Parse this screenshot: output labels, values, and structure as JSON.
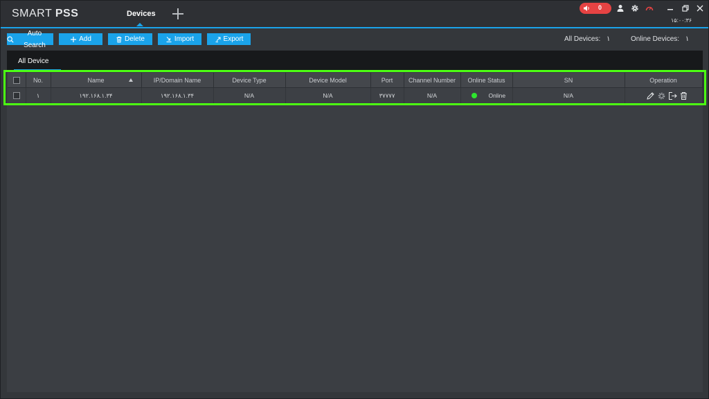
{
  "app": {
    "logo_thin": "SMART ",
    "logo_bold": "PSS",
    "active_tab": "Devices",
    "alarm_count": "0",
    "clock": "۱۵:۰۰:۳۶"
  },
  "toolbar": {
    "auto_search": "Auto Search",
    "add": "Add",
    "delete": "Delete",
    "import": "Import",
    "export": "Export",
    "all_devices_label": "All Devices:",
    "all_devices_count": "۱",
    "online_devices_label": "Online Devices:",
    "online_devices_count": "۱"
  },
  "subtabs": {
    "all_device": "All Device"
  },
  "table": {
    "headers": {
      "no": "No.",
      "name": "Name",
      "ip": "IP/Domain Name",
      "type": "Device Type",
      "model": "Device Model",
      "port": "Port",
      "channel": "Channel Number",
      "status": "Online Status",
      "sn": "SN",
      "operation": "Operation"
    },
    "rows": [
      {
        "no": "۱",
        "name": "۱۹۲.۱۶۸.۱.۳۴",
        "ip": "۱۹۲.۱۶۸.۱.۳۴",
        "type": "N/A",
        "model": "N/A",
        "port": "۳۷۷۷۷",
        "channel": "N/A",
        "status": "Online",
        "sn": "N/A"
      }
    ]
  },
  "colors": {
    "accent": "#1aa3ea",
    "highlight_frame": "#4cff12",
    "online": "#2ee52e",
    "alarm": "#e64343"
  },
  "icons": [
    "speaker-icon",
    "user-icon",
    "gear-icon",
    "speedometer-icon",
    "minimize-icon",
    "restore-icon",
    "close-icon",
    "search-icon",
    "plus-icon",
    "trash-icon",
    "import-icon",
    "export-icon",
    "edit-icon",
    "settings-icon",
    "logout-icon"
  ]
}
